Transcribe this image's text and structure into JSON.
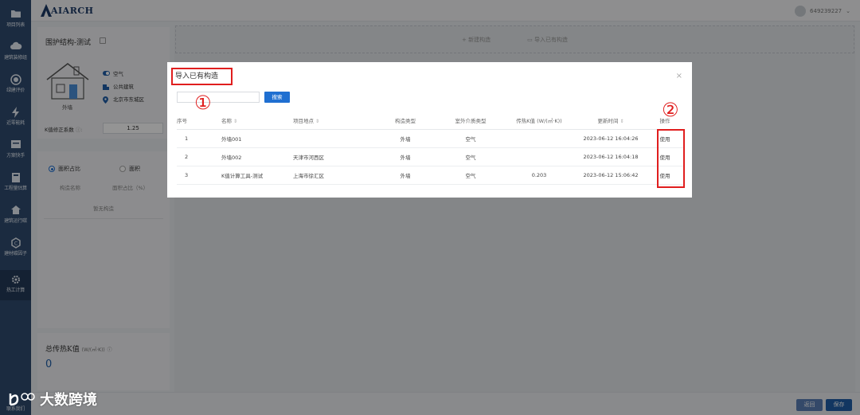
{
  "brand": {
    "logo_text": "AIARCH"
  },
  "user": {
    "id": "649239227"
  },
  "sidebar": {
    "items": [
      {
        "label": "项目列表",
        "icon": "folder-icon"
      },
      {
        "label": "建筑装修组",
        "icon": "cloud-icon"
      },
      {
        "label": "绿建评价",
        "icon": "medal-icon"
      },
      {
        "label": "近零能耗",
        "icon": "lightning-icon"
      },
      {
        "label": "方案快手",
        "icon": "box-icon"
      },
      {
        "label": "工程量估算",
        "icon": "calculator-icon"
      },
      {
        "label": "建筑运行碳",
        "icon": "home-icon"
      },
      {
        "label": "建材碳因子",
        "icon": "factor-icon"
      },
      {
        "label": "热工计算",
        "icon": "gear-icon"
      },
      {
        "label": "联系我们",
        "icon": "contact-icon"
      }
    ]
  },
  "left_panel": {
    "struct_title": "围护结构-测试",
    "wall_label": "外墙",
    "attributes": [
      {
        "text": "空气",
        "icon": "toggle-icon"
      },
      {
        "text": "公共建筑",
        "icon": "building-icon"
      },
      {
        "text": "北京市东城区",
        "icon": "location-icon"
      }
    ],
    "k_factor_label": "K值修正系数",
    "k_factor_value": "1.25",
    "radio_area_ratio": "面积占比",
    "radio_area": "面积",
    "col_struct_name": "构造名称",
    "col_area_ratio": "面积占比（%）",
    "empty_text": "暂无构造",
    "total_k_title": "总传热K值",
    "total_k_unit": "(W/(㎡·K))",
    "total_k_value": "0"
  },
  "main_area": {
    "new_struct": "+ 新建构造",
    "import_struct": "导入已有构造"
  },
  "modal": {
    "title": "导入已有构造",
    "close": "×",
    "search_placeholder": "",
    "search_button": "搜索",
    "columns": [
      "序号",
      "名称",
      "项目地点",
      "构造类型",
      "室外介质类型",
      "传热K值 (W/(㎡·K))",
      "更新时间",
      "操作"
    ],
    "rows": [
      {
        "no": "1",
        "name": "外墙001",
        "location": "",
        "type": "外墙",
        "medium": "空气",
        "k": "",
        "updated": "2023-06-12 16:04:26",
        "action": "使用"
      },
      {
        "no": "2",
        "name": "外墙002",
        "location": "天津市河西区",
        "type": "外墙",
        "medium": "空气",
        "k": "",
        "updated": "2023-06-12 16:04:18",
        "action": "使用"
      },
      {
        "no": "3",
        "name": "K值计算工具-测试",
        "location": "上海市徐汇区",
        "type": "外墙",
        "medium": "空气",
        "k": "0.203",
        "updated": "2023-06-12 15:06:42",
        "action": "使用"
      }
    ]
  },
  "annotations": {
    "one": "①",
    "two": "②"
  },
  "footer": {
    "cancel": "返回",
    "save": "保存"
  },
  "watermark": {
    "text": "大数跨境"
  },
  "colors": {
    "sidebar": "#2f4a6e",
    "primary": "#1f6fd1",
    "annotation": "#e01e1e"
  }
}
